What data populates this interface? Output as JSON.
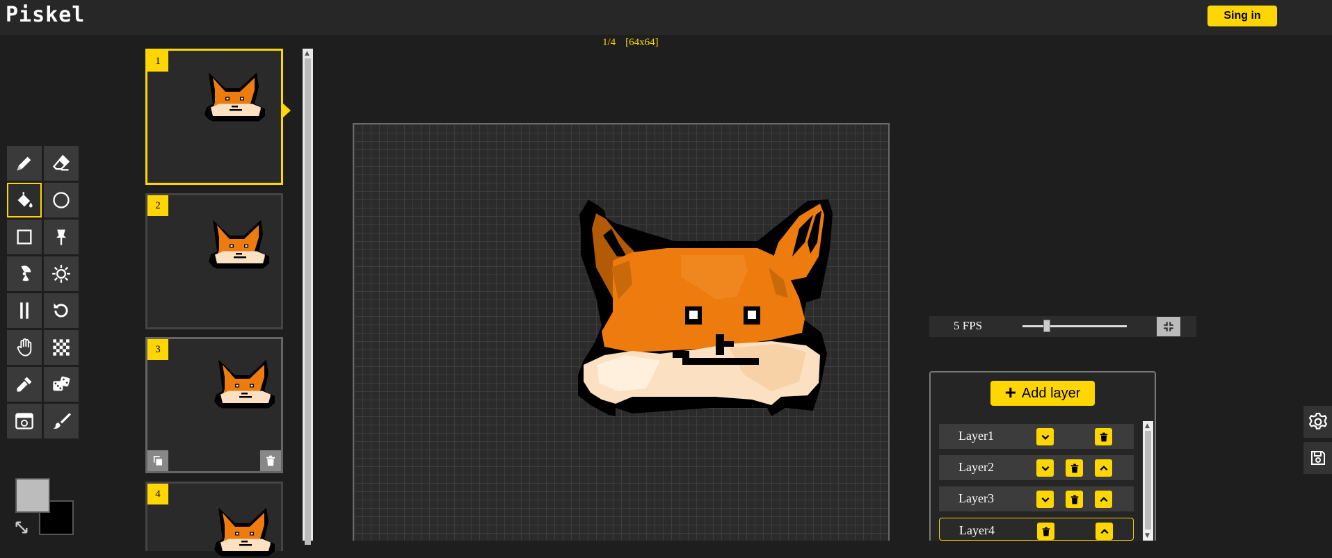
{
  "header": {
    "logo": "Piskel",
    "sign_in_label": "Sing in"
  },
  "frame_info": {
    "index": "1/4",
    "size": "[64x64]"
  },
  "tools": [
    {
      "name": "pen-icon",
      "selected": false
    },
    {
      "name": "eraser-icon",
      "selected": false
    },
    {
      "name": "paint-bucket-icon",
      "selected": true
    },
    {
      "name": "circle-icon",
      "selected": false
    },
    {
      "name": "rectangle-icon",
      "selected": false
    },
    {
      "name": "stroke-icon",
      "selected": false
    },
    {
      "name": "radiation-icon",
      "selected": false
    },
    {
      "name": "lighten-icon",
      "selected": false
    },
    {
      "name": "vertical-mirror-icon",
      "selected": false
    },
    {
      "name": "rotate-icon",
      "selected": false
    },
    {
      "name": "hand-icon",
      "selected": false
    },
    {
      "name": "checker-icon",
      "selected": false
    },
    {
      "name": "eyedropper-icon",
      "selected": false
    },
    {
      "name": "dice-icon",
      "selected": false
    },
    {
      "name": "calendar-icon",
      "selected": false
    },
    {
      "name": "brush-icon",
      "selected": false
    }
  ],
  "colors": {
    "primary": "#bcbcbc",
    "secondary": "#000000",
    "accent": "#ffd600"
  },
  "frames": [
    {
      "number": "1",
      "selected": true
    },
    {
      "number": "2",
      "selected": false
    },
    {
      "number": "3",
      "selected": false
    },
    {
      "number": "4",
      "selected": false
    }
  ],
  "fps": {
    "label": "5 FPS",
    "value": 5
  },
  "layers": {
    "add_label": "Add layer",
    "items": [
      {
        "name": "Layer1",
        "selected": false
      },
      {
        "name": "Layer2",
        "selected": false
      },
      {
        "name": "Layer3",
        "selected": false
      },
      {
        "name": "Layer4",
        "selected": true
      }
    ]
  },
  "side_buttons": [
    "gear-icon",
    "save-icon"
  ]
}
